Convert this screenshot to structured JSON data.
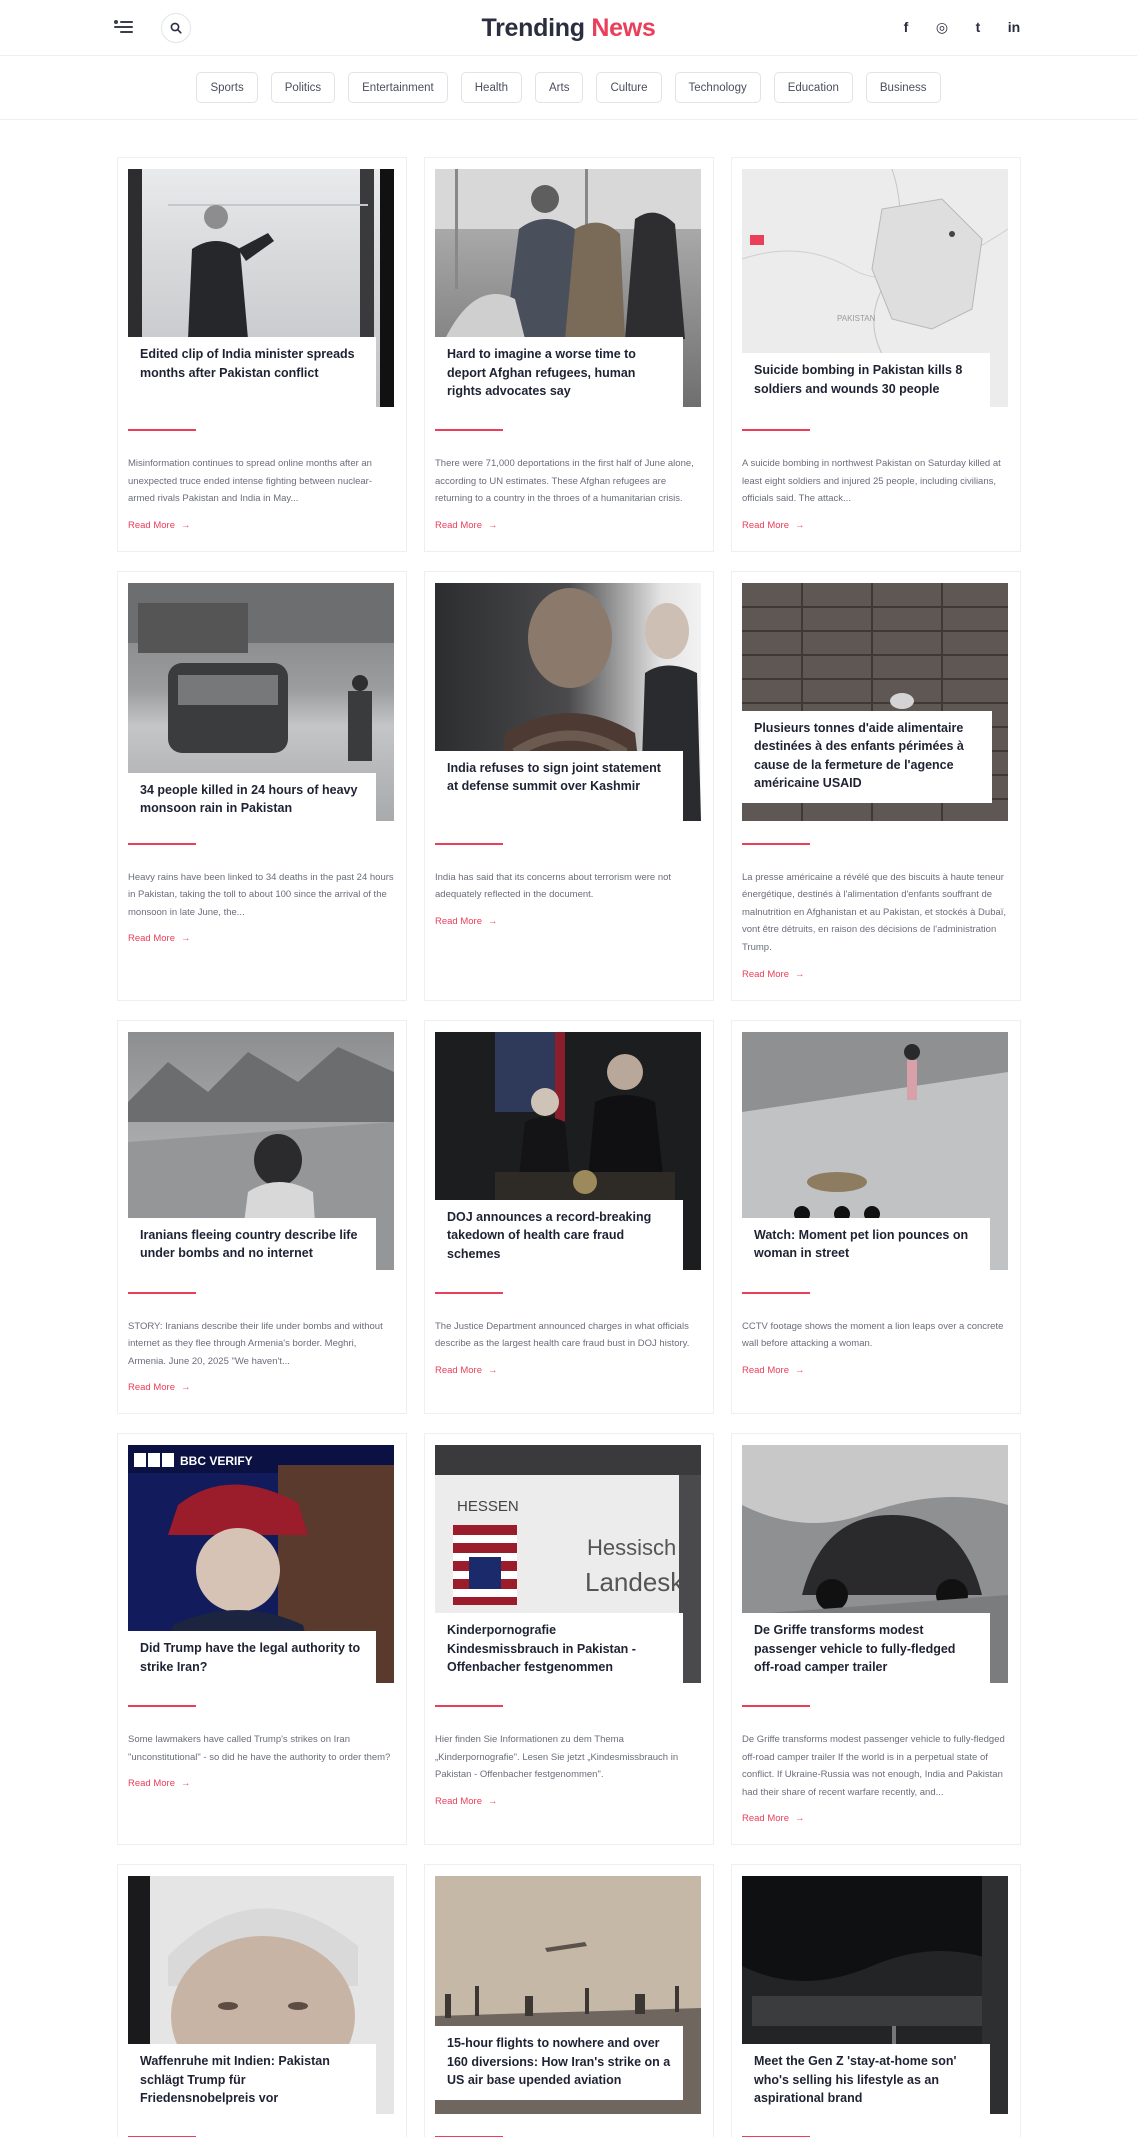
{
  "header": {
    "logo_part1": "Trending",
    "logo_part2": "News",
    "menu_icon": "menu-icon",
    "search_icon": "search-icon",
    "socials": [
      {
        "icon": "facebook-icon",
        "glyph": "f"
      },
      {
        "icon": "instagram-icon",
        "glyph": "◎"
      },
      {
        "icon": "twitter-icon",
        "glyph": "t"
      },
      {
        "icon": "linkedin-icon",
        "glyph": "in"
      }
    ]
  },
  "categories": [
    "Sports",
    "Politics",
    "Entertainment",
    "Health",
    "Arts",
    "Culture",
    "Technology",
    "Education",
    "Business"
  ],
  "colors": {
    "accent": "#ea3e5a",
    "text": "#1f2233"
  },
  "read_more": "Read More",
  "articles": [
    {
      "title": "Edited clip of India minister spreads months after Pakistan conflict",
      "excerpt": "Misinformation continues to spread online months after an unexpected truce ended intense fighting between nuclear-armed rivals Pakistan and India in May..."
    },
    {
      "title": "Hard to imagine a worse time to deport Afghan refugees, human rights advocates say",
      "excerpt": "There were 71,000 deportations in the first half of June alone, according to UN estimates. These Afghan refugees are returning to a country in the throes of a humanitarian crisis."
    },
    {
      "title": "Suicide bombing in Pakistan kills 8 soldiers and wounds 30 people",
      "excerpt": "A suicide bombing in northwest Pakistan on Saturday killed at least eight soldiers and injured 25 people, including civilians, officials said. The attack..."
    },
    {
      "title": "34 people killed in 24 hours of heavy monsoon rain in Pakistan",
      "excerpt": "Heavy rains have been linked to 34 deaths in the past 24 hours in Pakistan, taking the toll to about 100 since the arrival of the monsoon in late June, the..."
    },
    {
      "title": "India refuses to sign joint statement at defense summit over Kashmir",
      "excerpt": "India has said that its concerns about terrorism were not adequately reflected in the document."
    },
    {
      "title": "Plusieurs tonnes d'aide alimentaire destinées à des enfants périmées à cause de la fermeture de l'agence américaine USAID",
      "excerpt": "La presse américaine a révélé que des biscuits à haute teneur énergétique, destinés à l'alimentation d'enfants souffrant de malnutrition en Afghanistan et au Pakistan, et stockés à Dubaï, vont être détruits, en raison des décisions de l'administration Trump."
    },
    {
      "title": "Iranians fleeing country describe life under bombs and no internet",
      "excerpt": "STORY: Iranians describe their life under bombs and without internet as they flee through Armenia's border. Meghri, Armenia. June 20, 2025 \"We haven't..."
    },
    {
      "title": "DOJ announces a record-breaking takedown of health care fraud schemes",
      "excerpt": "The Justice Department announced charges in what officials describe as the largest health care fraud bust in DOJ history."
    },
    {
      "title": "Watch: Moment pet lion pounces on woman in street",
      "excerpt": "CCTV footage shows the moment a lion leaps over a concrete wall before attacking a woman."
    },
    {
      "title": "Did Trump have the legal authority to strike Iran?",
      "excerpt": "Some lawmakers have called Trump's strikes on Iran \"unconstitutional\" - so did he have the authority to order them?",
      "badge": "BBC VERIFY"
    },
    {
      "title": "Kinderpornografie Kindesmissbrauch in Pakistan - Offenbacher festgenommen",
      "excerpt": "Hier finden Sie Informationen zu dem Thema „Kinderpornografie\". Lesen Sie jetzt „Kindesmissbrauch in Pakistan - Offenbacher festgenommen\".",
      "sign1": "HESSEN",
      "sign2": "Hessisch",
      "sign3": "Landeskrim"
    },
    {
      "title": "De Griffe transforms modest passenger vehicle to fully-fledged off-road camper trailer",
      "excerpt": "De Griffe transforms modest passenger vehicle to fully-fledged off-road camper trailer If the world is in a perpetual state of conflict. If Ukraine-Russia was not enough, India and Pakistan had their share of recent warfare recently, and..."
    },
    {
      "title": "Waffenruhe mit Indien: Pakistan schlägt Trump für Friedensnobelpreis vor"
    },
    {
      "title": "15-hour flights to nowhere and over 160 diversions: How Iran's strike on a US air base upended aviation"
    },
    {
      "title": "Meet the Gen Z 'stay-at-home son' who's selling his lifestyle as an aspirational brand"
    }
  ]
}
